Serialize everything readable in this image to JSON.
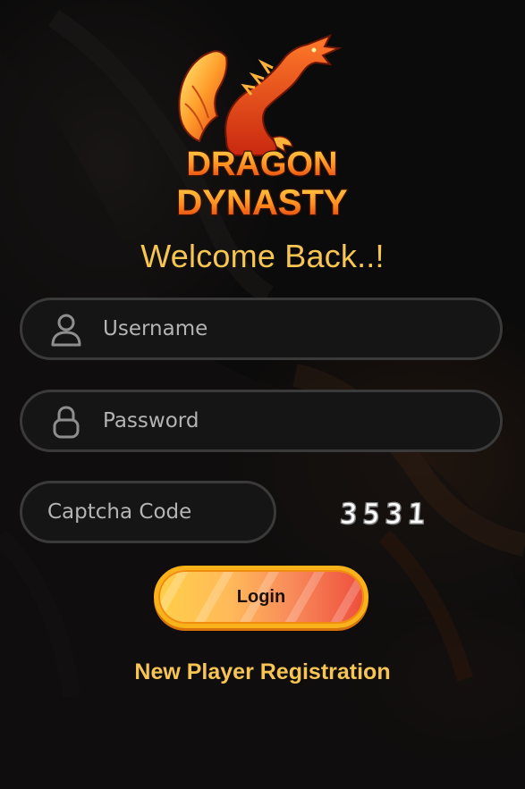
{
  "brand": {
    "logo_text_line1": "DRAGON",
    "logo_text_line2": "DYNASTY",
    "logo_icon": "dragon-logo-icon",
    "accent_color": "#f7c552"
  },
  "login_form": {
    "heading": "Welcome Back..!",
    "username": {
      "placeholder": "Username",
      "value": "",
      "icon": "user-icon"
    },
    "password": {
      "placeholder": "Password",
      "value": "",
      "icon": "lock-icon"
    },
    "captcha": {
      "placeholder": "Captcha Code",
      "value": "",
      "code": "3531"
    },
    "login_label": "Login",
    "register_label": "New Player Registration"
  }
}
